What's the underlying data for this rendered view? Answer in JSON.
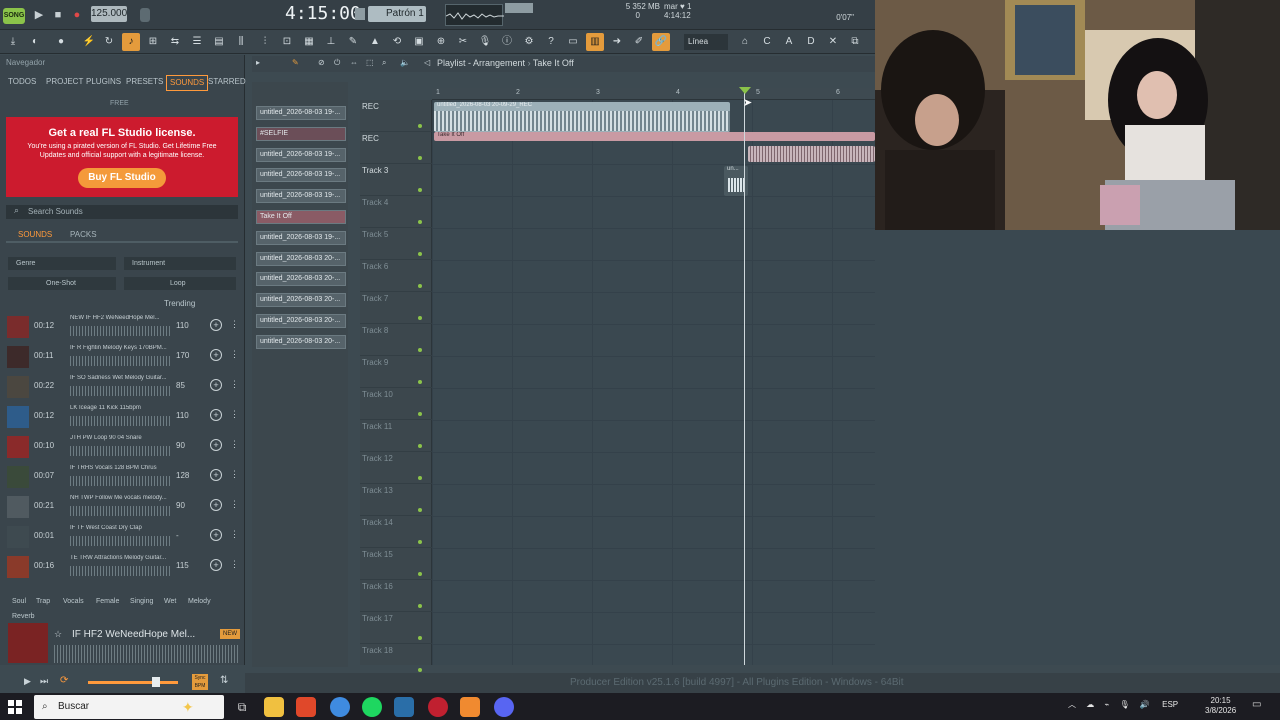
{
  "transport": {
    "logo": "SONG",
    "tempo": "125.000",
    "time": "4:15:00",
    "pattern": "Patrón 1",
    "memory_line1": "5   352 MB",
    "memory_line2": "0",
    "cpu_line1": "mar ♥  1",
    "cpu_line2": "4:14:12",
    "cpu_line3": "0'07\""
  },
  "toolbar": {
    "snap": "Línea"
  },
  "browser": {
    "nav_title": "Navegador",
    "tabs": [
      "TODOS",
      "PROJECT",
      "PLUGINS",
      "PRESETS",
      "SOUNDS",
      "STARRED"
    ],
    "active_tab": "SOUNDS",
    "free_label": "FREE",
    "promo": {
      "title": "Get a real FL Studio license.",
      "body": "You're using a pirated version of FL Studio. Get Lifetime Free Updates and official support with a legitimate license.",
      "button": "Buy FL Studio"
    },
    "search_placeholder": "Search Sounds",
    "sound_tabs": [
      "SOUNDS",
      "PACKS"
    ],
    "filters": {
      "genre": "Genre",
      "instrument": "Instrument",
      "oneshot": "One-Shot",
      "loop": "Loop"
    },
    "trending": "Trending",
    "sounds": [
      {
        "dur": "00:12",
        "name": "NEW IF HF2 WeNeedHope Mel...",
        "bpm": "110",
        "color": "#7a2c2c"
      },
      {
        "dur": "00:11",
        "name": "IF R Fightin Melody Keys 170BPM...",
        "bpm": "170",
        "color": "#3d2a2a"
      },
      {
        "dur": "00:22",
        "name": "IF SO Sadness Wet Melody Guitar...",
        "bpm": "85",
        "color": "#4b4740"
      },
      {
        "dur": "00:12",
        "name": "LK Iceage 11 Kick 115bpm",
        "bpm": "110",
        "color": "#2e5c8a"
      },
      {
        "dur": "00:10",
        "name": "JTH PW Loop 90 04 Snare",
        "bpm": "90",
        "color": "#8a2a2a"
      },
      {
        "dur": "00:07",
        "name": "IF TRHS Vocals 128 BPM Chrus",
        "bpm": "128",
        "color": "#3a4a3a"
      },
      {
        "dur": "00:21",
        "name": "NH TWP Follow Me vocals melody...",
        "bpm": "90",
        "color": "#505a60"
      },
      {
        "dur": "00:01",
        "name": "IF TF West Coast Dry Clap",
        "bpm": "-",
        "color": "#3e4a50"
      },
      {
        "dur": "00:16",
        "name": "TE TRW Attractions Melody Guitar...",
        "bpm": "115",
        "color": "#8a3a2a"
      }
    ],
    "tags": [
      "Soul",
      "Trap",
      "Vocals",
      "Female",
      "Singing",
      "Wet",
      "Melody",
      "Reverb"
    ],
    "player_title": "IF HF2 WeNeedHope Mel...",
    "player_badge": "NEW",
    "sync_label": "Sync BPM"
  },
  "clips": [
    "untitled_2026-08-03 19-...",
    "#SELFIE",
    "untitled_2026-08-03 19-...",
    "untitled_2026-08-03 19-...",
    "untitled_2026-08-03 19-...",
    "Take It Off",
    "untitled_2026-08-03 19-...",
    "untitled_2026-08-03 20-...",
    "untitled_2026-08-03 20-...",
    "untitled_2026-08-03 20-...",
    "untitled_2026-08-03 20-...",
    "untitled_2026-08-03 20-..."
  ],
  "playlist": {
    "title": "Playlist - Arrangement",
    "crumb": "Take It Off",
    "ruler": [
      "1",
      "2",
      "3",
      "4",
      "5",
      "6"
    ],
    "tracks": [
      "REC",
      "REC",
      "Track 3",
      "Track 4",
      "Track 5",
      "Track 6",
      "Track 7",
      "Track 8",
      "Track 9",
      "Track 10",
      "Track 11",
      "Track 12",
      "Track 13",
      "Track 14",
      "Track 15",
      "Track 16",
      "Track 17",
      "Track 18"
    ],
    "audio_clip_1": "untitled_2026-08-03 20-09-29_REC",
    "audio_clip_2": "Take It Off",
    "audio_clip_3": "un..."
  },
  "status": "Producer Edition v25.1.6 [build 4997] - All Plugins Edition - Windows - 64Bit",
  "taskbar": {
    "search": "Buscar",
    "lang": "ESP",
    "time": "20:15",
    "date": "3/8/2026"
  }
}
